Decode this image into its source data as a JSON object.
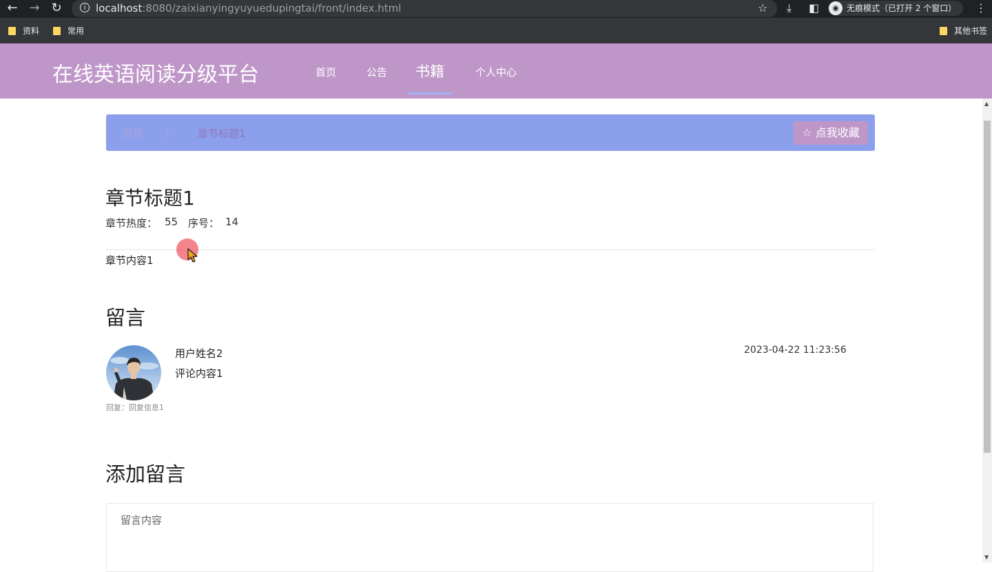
{
  "browser": {
    "url_host": "localhost",
    "url_rest": ":8080/zaixianyingyuyuedupingtai/front/index.html",
    "incognito_label": "无痕模式（已打开 2 个窗口）",
    "bookmarks": [
      "资料",
      "常用"
    ],
    "other_bookmarks": "其他书签"
  },
  "site": {
    "title": "在线英语阅读分级平台",
    "nav": [
      "首页",
      "公告",
      "书籍",
      "个人中心"
    ],
    "active_nav": "书籍"
  },
  "breadcrumb": {
    "home": "首页",
    "separator": "/",
    "current": "章节标题1",
    "favorite_label": "☆ 点我收藏"
  },
  "chapter": {
    "title": "章节标题1",
    "heat_label": "章节热度：",
    "heat_value": "55",
    "order_label": "序号：",
    "order_value": "14",
    "content": "章节内容1"
  },
  "comments": {
    "title": "留言",
    "items": [
      {
        "user": "用户姓名2",
        "text": "评论内容1",
        "time": "2023-04-22 11:23:56",
        "reply": "回复：回复信息1"
      }
    ]
  },
  "add_comment": {
    "title": "添加留言",
    "placeholder": "留言内容"
  },
  "colors": {
    "header_bg": "#bf96c8",
    "breadcrumb_bg": "#8c9fec",
    "favorite_button_bg": "#bf96c8"
  }
}
